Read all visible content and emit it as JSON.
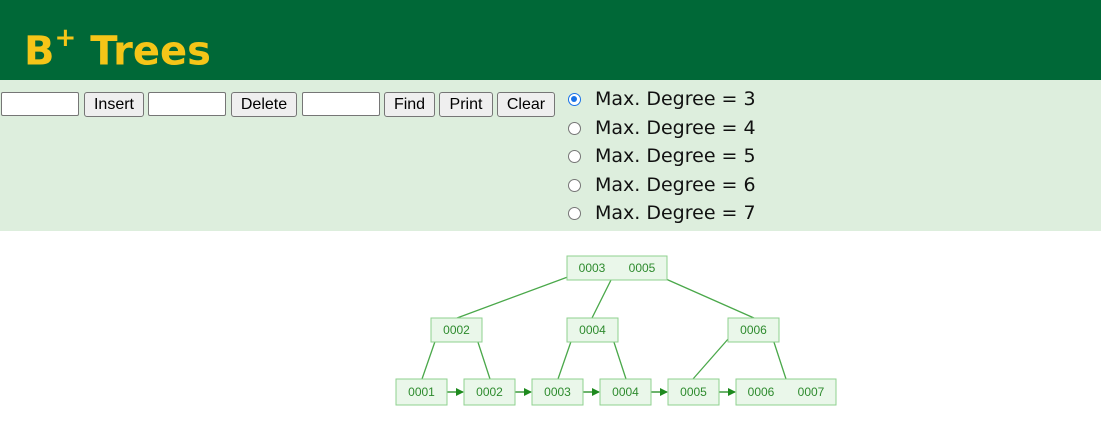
{
  "header": {
    "title_main": "B",
    "title_sup": "+",
    "title_rest": " Trees",
    "background": "#006837",
    "title_color": "#f5c518"
  },
  "controls": {
    "insert_input_value": "",
    "insert_label": "Insert",
    "delete_input_value": "",
    "delete_label": "Delete",
    "find_input_value": "",
    "find_label": "Find",
    "print_label": "Print",
    "clear_label": "Clear",
    "background": "#ddeedd"
  },
  "degree_options": [
    {
      "label": "Max. Degree = 3",
      "checked": true
    },
    {
      "label": "Max. Degree = 4",
      "checked": false
    },
    {
      "label": "Max. Degree = 5",
      "checked": false
    },
    {
      "label": "Max. Degree = 6",
      "checked": false
    },
    {
      "label": "Max. Degree = 7",
      "checked": false
    }
  ],
  "tree": {
    "root": {
      "keys": [
        "0003",
        "0005"
      ]
    },
    "internal": [
      {
        "keys": [
          "0002"
        ]
      },
      {
        "keys": [
          "0004"
        ]
      },
      {
        "keys": [
          "0006"
        ]
      }
    ],
    "leaves": [
      {
        "keys": [
          "0001"
        ]
      },
      {
        "keys": [
          "0002"
        ]
      },
      {
        "keys": [
          "0003"
        ]
      },
      {
        "keys": [
          "0004"
        ]
      },
      {
        "keys": [
          "0005"
        ]
      },
      {
        "keys": [
          "0006",
          "0007"
        ]
      }
    ]
  }
}
